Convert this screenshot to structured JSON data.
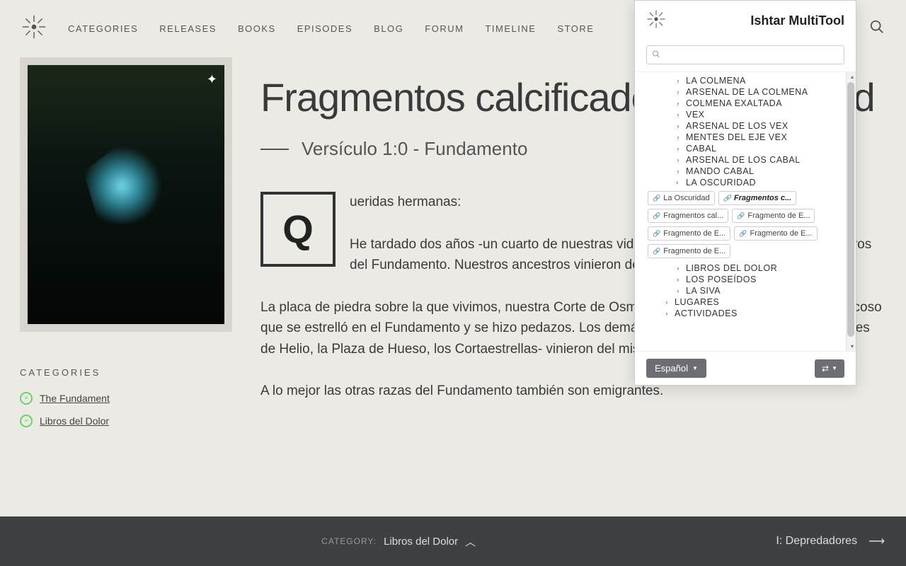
{
  "nav": {
    "links": [
      "CATEGORIES",
      "RELEASES",
      "BOOKS",
      "EPISODES",
      "BLOG",
      "FORUM",
      "TIMELINE",
      "STORE"
    ]
  },
  "page": {
    "title": "Fragmentos calcificados: Curiosidad",
    "subtitle": "Versículo 1:0 - Fundamento",
    "dropcap": "Q",
    "para1_line1": "ueridas hermanas:",
    "para1_line2": "He tardado dos años -un cuarto de nuestras vidas- en entender esto. No somos nativos del Fundamento. Nuestros ancestros vinieron de otra parte.",
    "para2": "La placa de piedra sobre la que vivimos, nuestra Corte de Osmio, es un fragmento de un planeta rocoso que se estrelló en el Fundamento y se hizo pedazos. Los demás continentes cercanos -los Bebedores de Helio, la Plaza de Hueso, los Cortaestrellas- vinieron del mismo mundo.",
    "para3": "A lo mejor las otras razas del Fundamento también son emigrantes."
  },
  "sidebar": {
    "heading": "CATEGORIES",
    "items": [
      {
        "label": "The Fundament"
      },
      {
        "label": "Libros del Dolor"
      }
    ]
  },
  "bottom": {
    "category_label": "CATEGORY:",
    "category_value": "Libros del Dolor",
    "next_label": "I: Depredadores"
  },
  "ext": {
    "title": "Ishtar MultiTool",
    "search_placeholder": "",
    "tree": [
      {
        "label": "LA COLMENA",
        "level": 2,
        "expanded": false
      },
      {
        "label": "ARSENAL DE LA COLMENA",
        "level": 2,
        "expanded": false
      },
      {
        "label": "COLMENA EXALTADA",
        "level": 2,
        "expanded": false
      },
      {
        "label": "VEX",
        "level": 2,
        "expanded": false
      },
      {
        "label": "ARSENAL DE LOS VEX",
        "level": 2,
        "expanded": false
      },
      {
        "label": "MENTES DEL EJE VEX",
        "level": 2,
        "expanded": false
      },
      {
        "label": "CABAL",
        "level": 2,
        "expanded": false
      },
      {
        "label": "ARSENAL DE LOS CABAL",
        "level": 2,
        "expanded": false
      },
      {
        "label": "MANDO CABAL",
        "level": 2,
        "expanded": false
      },
      {
        "label": "LA OSCURIDAD",
        "level": 2,
        "expanded": true
      }
    ],
    "chips": [
      {
        "label": "La Oscuridad",
        "active": false
      },
      {
        "label": "Fragmentos c...",
        "active": true
      },
      {
        "label": "Fragmentos cal...",
        "active": false
      },
      {
        "label": "Fragmento de E...",
        "active": false
      },
      {
        "label": "Fragmento de E...",
        "active": false
      },
      {
        "label": "Fragmento de E...",
        "active": false
      },
      {
        "label": "Fragmento de E...",
        "active": false
      }
    ],
    "tree2": [
      {
        "label": "LIBROS DEL DOLOR",
        "level": 2,
        "expanded": false
      },
      {
        "label": "LOS POSEÍDOS",
        "level": 2,
        "expanded": false
      },
      {
        "label": "LA SIVA",
        "level": 2,
        "expanded": false
      },
      {
        "label": "LUGARES",
        "level": 1,
        "expanded": false
      },
      {
        "label": "ACTIVIDADES",
        "level": 1,
        "expanded": false
      }
    ],
    "language": "Español"
  }
}
